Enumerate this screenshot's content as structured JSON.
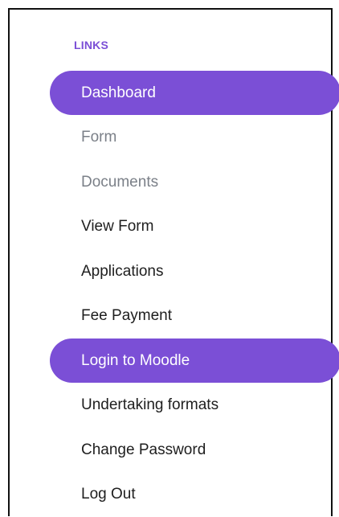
{
  "sidebar": {
    "section_title": "LINKS",
    "accent_color": "#7b4fd6",
    "items": [
      {
        "label": "Dashboard",
        "state": "active"
      },
      {
        "label": "Form",
        "state": "muted"
      },
      {
        "label": "Documents",
        "state": "muted"
      },
      {
        "label": "View Form",
        "state": "normal"
      },
      {
        "label": "Applications",
        "state": "normal"
      },
      {
        "label": "Fee Payment",
        "state": "normal"
      },
      {
        "label": "Login to Moodle",
        "state": "active"
      },
      {
        "label": "Undertaking formats",
        "state": "normal"
      },
      {
        "label": "Change Password",
        "state": "normal"
      },
      {
        "label": "Log Out",
        "state": "normal"
      }
    ]
  }
}
